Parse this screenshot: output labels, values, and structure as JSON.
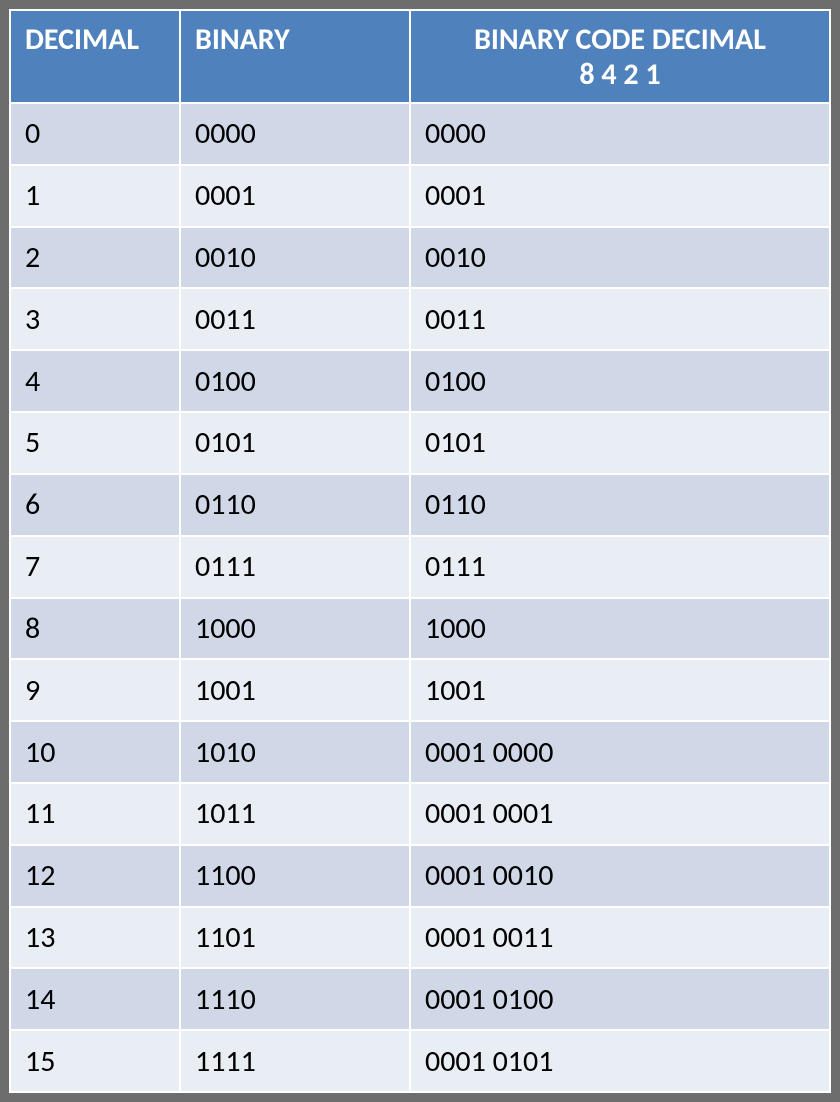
{
  "table": {
    "headers": {
      "decimal": "DECIMAL",
      "binary": "BINARY",
      "bcd_line1": "BINARY CODE DECIMAL",
      "bcd_line2": "8 4 2 1"
    },
    "rows": [
      {
        "decimal": "0",
        "binary": "0000",
        "bcd": "0000"
      },
      {
        "decimal": "1",
        "binary": "0001",
        "bcd": "0001"
      },
      {
        "decimal": "2",
        "binary": "0010",
        "bcd": "0010"
      },
      {
        "decimal": "3",
        "binary": "0011",
        "bcd": "0011"
      },
      {
        "decimal": "4",
        "binary": "0100",
        "bcd": "0100"
      },
      {
        "decimal": "5",
        "binary": "0101",
        "bcd": "0101"
      },
      {
        "decimal": "6",
        "binary": "0110",
        "bcd": "0110"
      },
      {
        "decimal": "7",
        "binary": "0111",
        "bcd": "0111"
      },
      {
        "decimal": "8",
        "binary": "1000",
        "bcd": "1000"
      },
      {
        "decimal": "9",
        "binary": "1001",
        "bcd": "1001"
      },
      {
        "decimal": "10",
        "binary": "1010",
        "bcd": "0001 0000"
      },
      {
        "decimal": "11",
        "binary": "1011",
        "bcd": "0001 0001"
      },
      {
        "decimal": "12",
        "binary": "1100",
        "bcd": "0001 0010"
      },
      {
        "decimal": "13",
        "binary": "1101",
        "bcd": "0001 0011"
      },
      {
        "decimal": "14",
        "binary": "1110",
        "bcd": "0001 0100"
      },
      {
        "decimal": "15",
        "binary": "1111",
        "bcd": "0001 0101"
      }
    ]
  }
}
